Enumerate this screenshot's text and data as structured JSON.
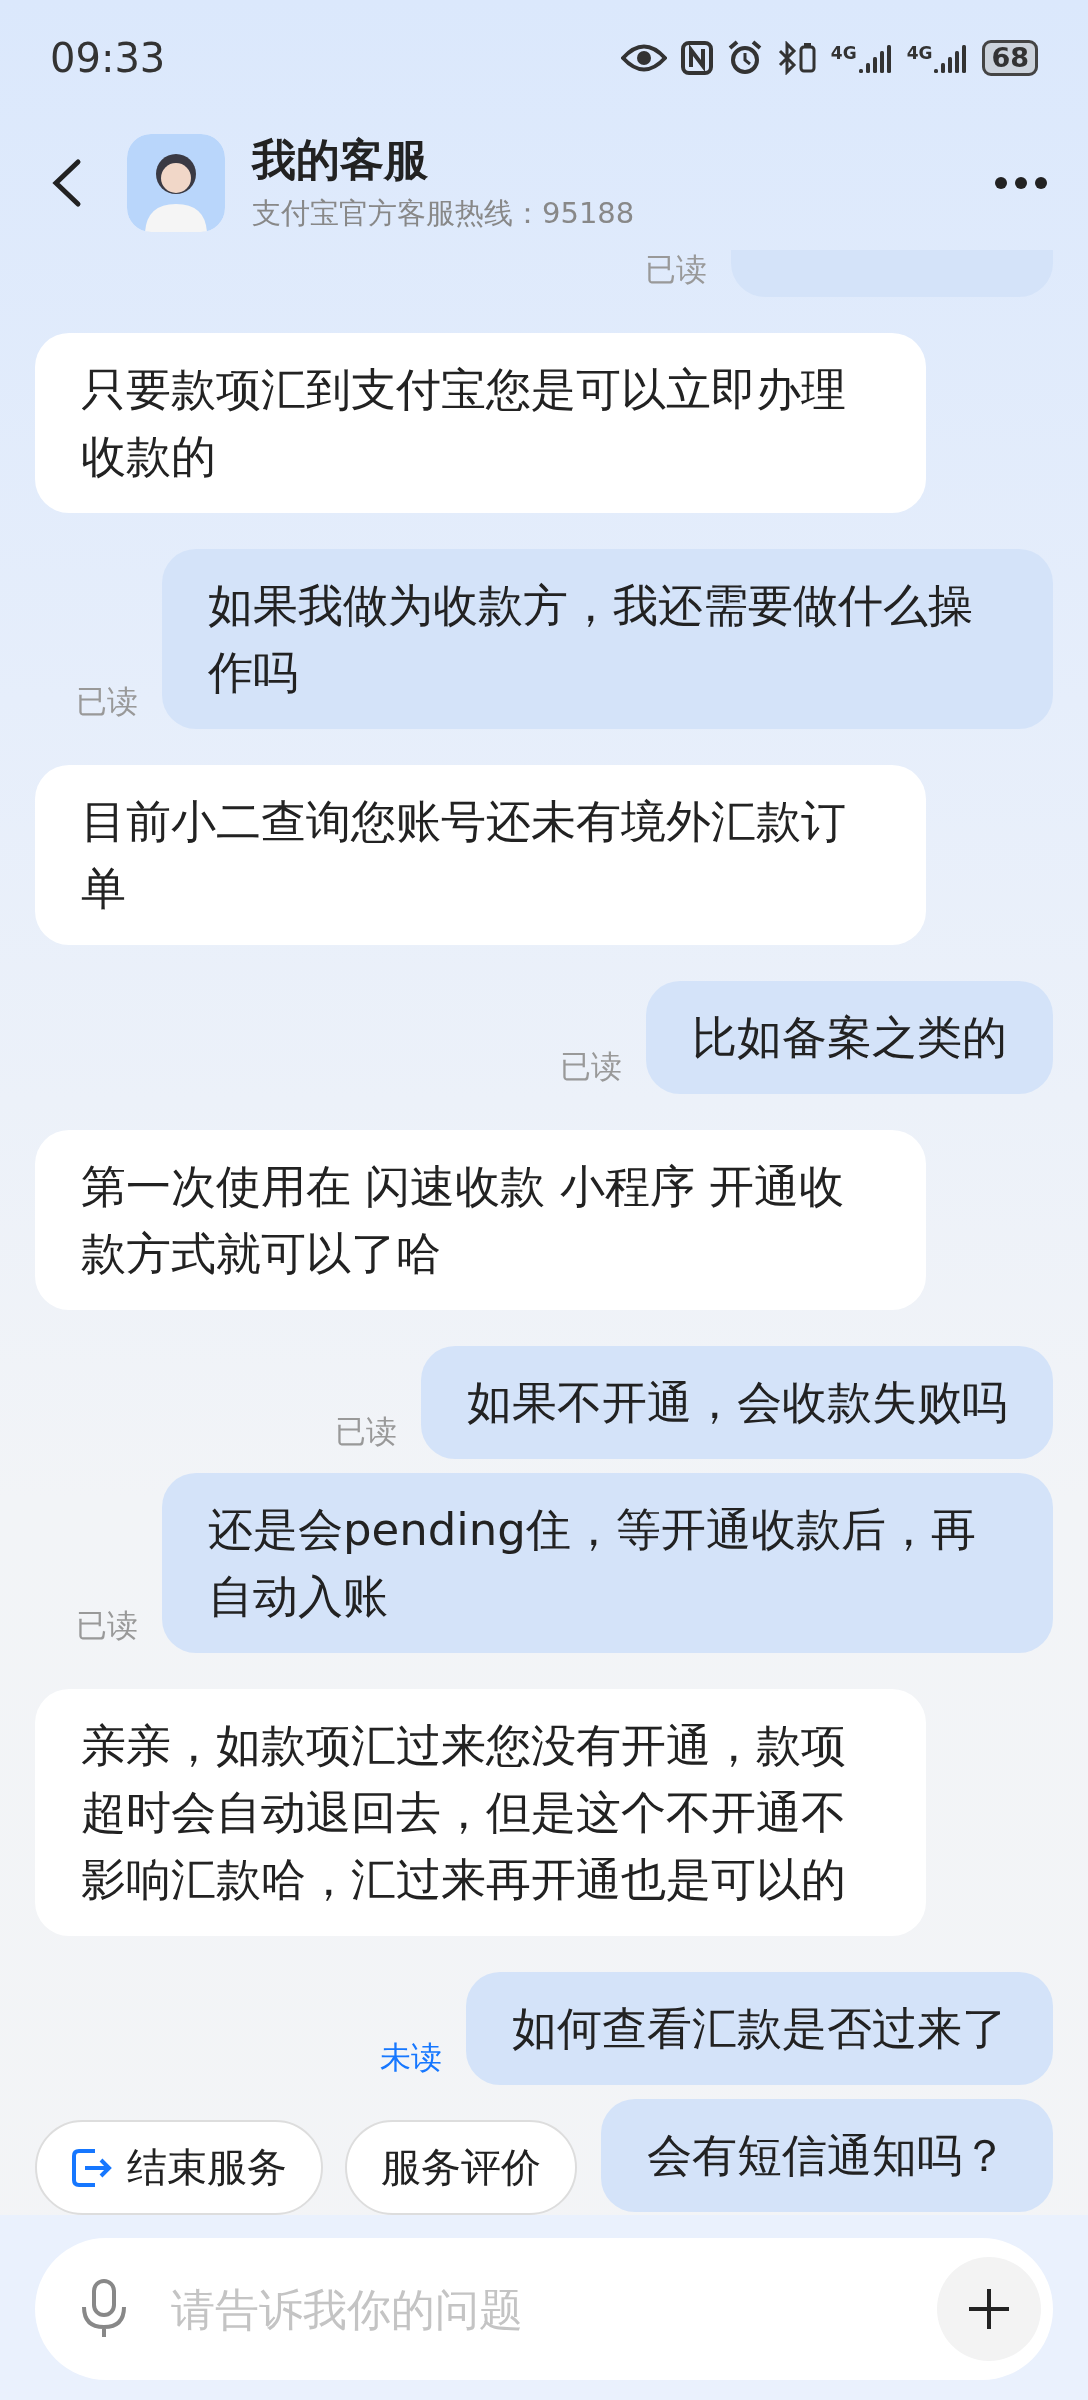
{
  "status_bar": {
    "time": "09:33",
    "network": [
      "4G",
      "4G"
    ],
    "battery": "68"
  },
  "header": {
    "title": "我的客服",
    "subtitle": "支付宝官方客服热线：95188"
  },
  "messages": [
    {
      "kind": "sent",
      "status": "已读",
      "read": true
    },
    {
      "kind": "received",
      "text": "只要款项汇到支付宝您是可以立即办理收款的"
    },
    {
      "kind": "sent",
      "text": "如果我做为收款方，我还需要做什么操作吗",
      "status": "已读",
      "read": true
    },
    {
      "kind": "received",
      "text": "目前小二查询您账号还未有境外汇款订单"
    },
    {
      "kind": "sent",
      "text": "比如备案之类的",
      "status": "已读",
      "read": true
    },
    {
      "kind": "received",
      "text": "第一次使用在 闪速收款 小程序 开通收款方式就可以了哈"
    },
    {
      "kind": "sent",
      "text": "如果不开通，会收款失败吗",
      "status": "已读",
      "read": true
    },
    {
      "kind": "sent",
      "text": "还是会pending住，等开通收款后，再自动入账",
      "status": "已读",
      "read": true
    },
    {
      "kind": "received",
      "text": "亲亲，如款项汇过来您没有开通，款项超时会自动退回去，但是这个不开通不影响汇款哈，汇过来再开通也是可以的"
    },
    {
      "kind": "sent",
      "text": "如何查看汇款是否过来了",
      "status": "未读",
      "read": false
    },
    {
      "kind": "sent",
      "text": "会有短信通知吗？"
    }
  ],
  "quick_actions": [
    {
      "label": "结束服务",
      "kind": "icon"
    },
    {
      "label": "服务评价",
      "kind": "plain"
    }
  ],
  "input": {
    "placeholder": "请告诉我你的问题"
  }
}
